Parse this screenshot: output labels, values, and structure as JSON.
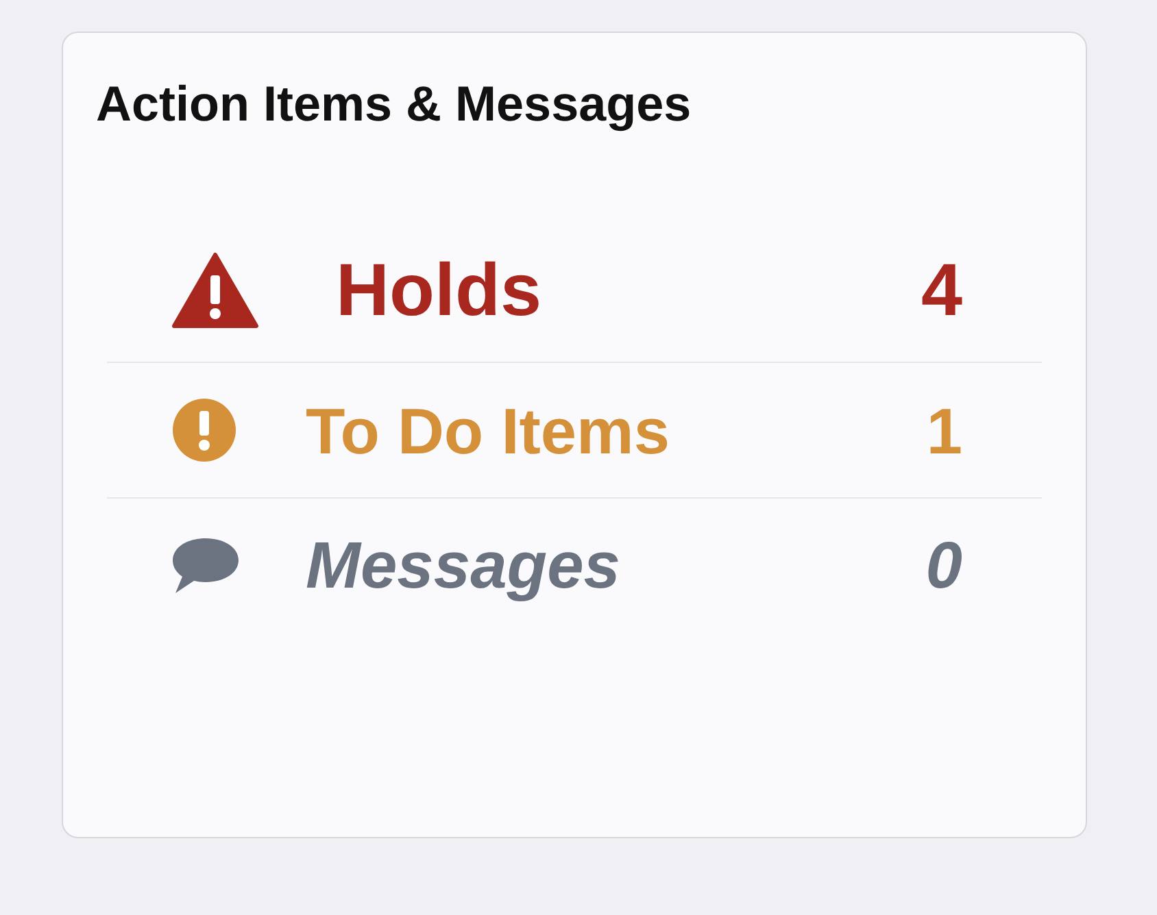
{
  "card": {
    "title": "Action Items & Messages",
    "items": [
      {
        "kind": "holds",
        "label": "Holds",
        "count": "4",
        "color": "#a8271e"
      },
      {
        "kind": "todo",
        "label": "To Do Items",
        "count": "1",
        "color": "#d4913a"
      },
      {
        "kind": "messages",
        "label": "Messages",
        "count": "0",
        "color": "#6b7280"
      }
    ]
  }
}
